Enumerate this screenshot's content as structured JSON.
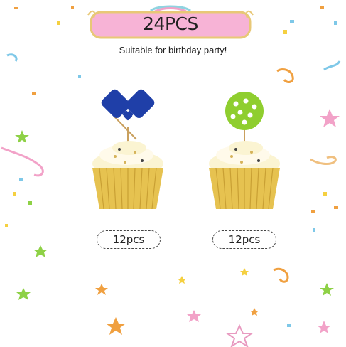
{
  "banner": {
    "label": "24PCS"
  },
  "subtitle": "Suitable for birthday party!",
  "products": [
    {
      "quantity": "12pcs",
      "topper_icon": "pickleball-paddles-icon",
      "topper_color": "#1f3fa8"
    },
    {
      "quantity": "12pcs",
      "topper_icon": "pickleball-icon",
      "topper_color": "#8fce2f"
    }
  ],
  "colors": {
    "banner_fill": "#f7b3d6",
    "banner_frame": "#e8c877",
    "cupcake_liner": "#e6c250",
    "frosting": "#fbf4d2"
  }
}
